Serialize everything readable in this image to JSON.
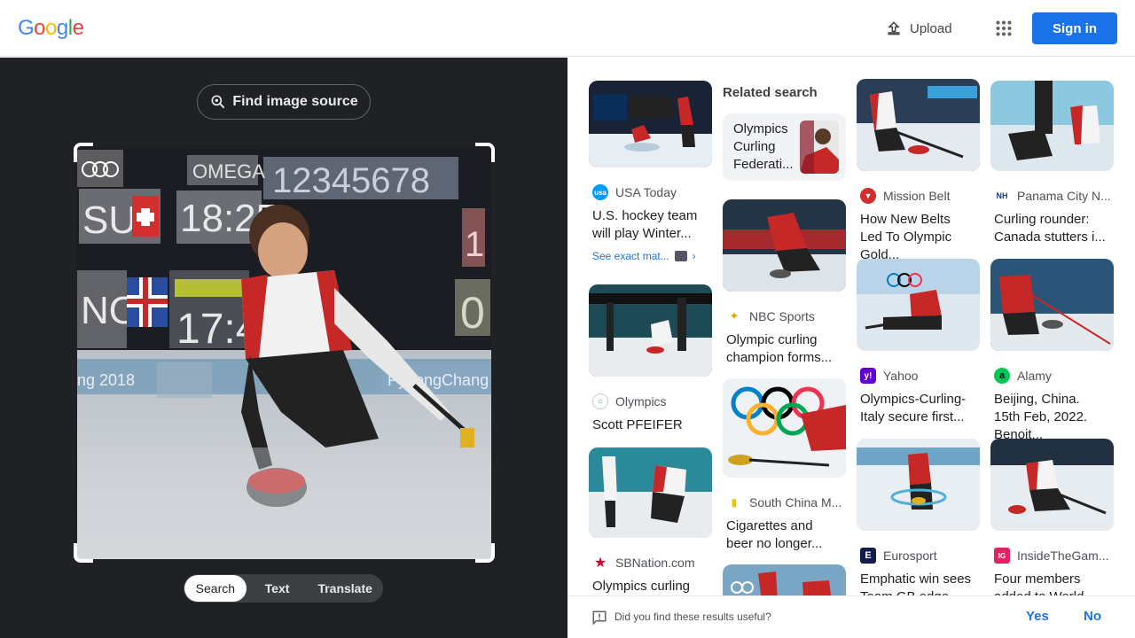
{
  "header": {
    "logo": [
      "G",
      "o",
      "o",
      "g",
      "l",
      "e"
    ],
    "logo_colors": [
      "#4285F4",
      "#EA4335",
      "#FBBC05",
      "#4285F4",
      "#34A853",
      "#EA4335"
    ],
    "upload_label": "Upload",
    "signin_label": "Sign in"
  },
  "left": {
    "find_source_label": "Find image source",
    "photo_overlay_text": {
      "scoreboard_digits": "12345678",
      "team1": "SUI",
      "time1": "18:25",
      "team2": "NOR",
      "time2": "17:4",
      "brand": "OMEGA",
      "score1": "1",
      "score2": "0",
      "venue": "PyeongChang 2018",
      "year": "ng 2018"
    },
    "modes": [
      "Search",
      "Text",
      "Translate"
    ],
    "active_mode": "Search"
  },
  "results": {
    "related": {
      "title": "Related search",
      "chip_label": "Olympics Curling Federati..."
    },
    "cards": [
      {
        "source": "USA Today",
        "title": "U.S. hockey team will play Winter...",
        "fav_color": "#009bff",
        "fav_text": "usa",
        "see_exact": "See exact mat..."
      },
      {
        "source": "Mission Belt",
        "title": "How New Belts Led To Olympic Gold...",
        "fav_color": "#d32f2f",
        "fav_text": "▼"
      },
      {
        "source": "Panama City N...",
        "title": "Curling rounder: Canada stutters i...",
        "fav_color": "#ffffff",
        "fav_text": "NH"
      },
      {
        "source": "Olympics",
        "title": "Scott PFEIFER",
        "fav_color": "#ffffff",
        "fav_text": "○"
      },
      {
        "source": "NBC Sports",
        "title": "Olympic curling champion forms...",
        "fav_color": "#ffffff",
        "fav_text": "✦"
      },
      {
        "source": "Yahoo",
        "title": "Olympics-Curling-Italy secure first...",
        "fav_color": "#6001d2",
        "fav_text": "y!"
      },
      {
        "source": "Alamy",
        "title": "Beijing, China. 15th Feb, 2022. Benoit...",
        "fav_color": "#00c853",
        "fav_text": "a"
      },
      {
        "source": "South China M...",
        "title": "Cigarettes and beer no longer...",
        "fav_color": "#ffffff",
        "fav_text": "▮"
      },
      {
        "source": "SBNation.com",
        "title": "Olympics curling",
        "fav_color": "#ffffff",
        "fav_text": "★"
      },
      {
        "source": "Eurosport",
        "title": "Emphatic win sees Team GB edge...",
        "fav_color": "#141b4d",
        "fav_text": "E"
      },
      {
        "source": "InsideTheGam...",
        "title": "Four members added to World...",
        "fav_color": "#e91e63",
        "fav_text": "IG"
      }
    ]
  },
  "feedback": {
    "question": "Did you find these results useful?",
    "yes": "Yes",
    "no": "No"
  }
}
